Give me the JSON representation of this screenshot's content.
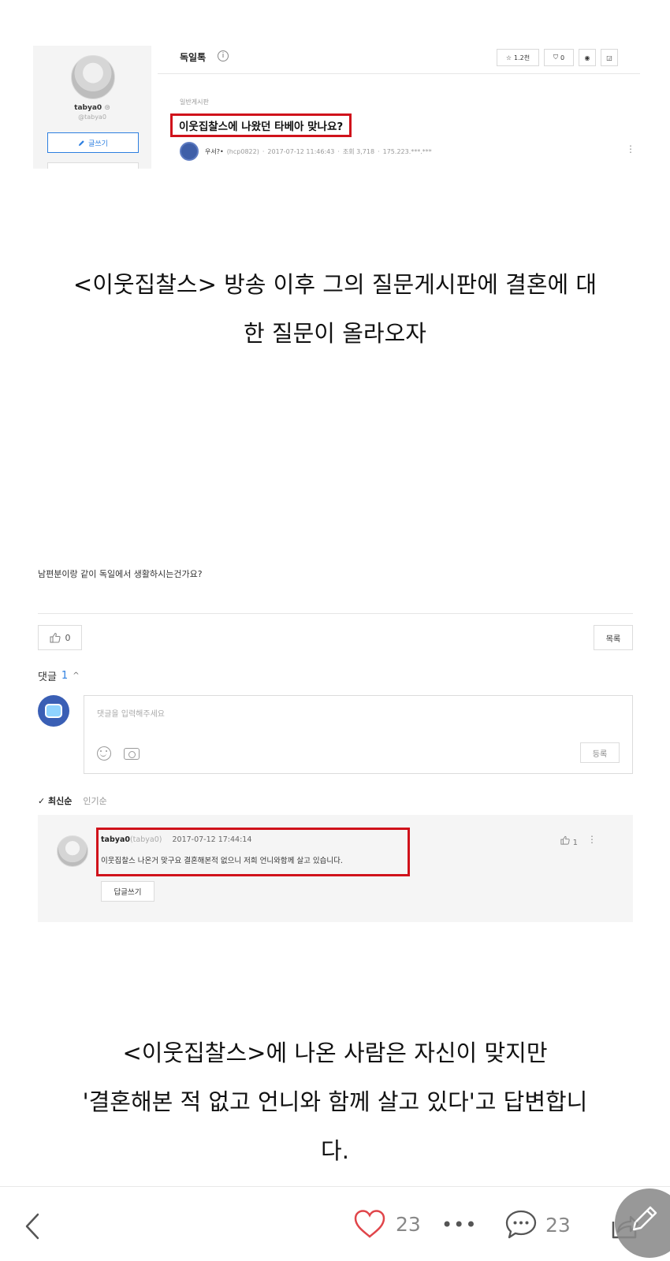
{
  "post_header": {
    "profile_name": "tabya0",
    "profile_badge": "⊜",
    "profile_id": "@tabya0",
    "write_label": "글쓰기",
    "board_title": "독일톡",
    "info_glyph": "i",
    "toolbar": {
      "favorite_count": "1.2천",
      "notify_count": "0"
    },
    "category": "일반게시판",
    "post_title": "이웃집찰스에 나왔던 타베아 맞나요?",
    "author": "우서?•",
    "author_id": "(hcp0822)",
    "date": "2017-07-12 11:46:43",
    "views": "조회 3,718",
    "ip": "175.223.***.***"
  },
  "captions": {
    "first": [
      "<이웃집찰스> 방송 이후 그의 질문게시판에 결혼에 대",
      "한 질문이 올라오자"
    ],
    "second": [
      "<이웃집찰스>에 나온 사람은 자신이 맞지만",
      "'결혼해본 적 없고 언니와 함께 살고 있다'고 답변합니",
      "다."
    ]
  },
  "question": {
    "text": "남편분이랑 같이 독일에서 생활하시는건가요?",
    "like_count": "0",
    "list_label": "목록"
  },
  "comments": {
    "label": "댓글",
    "count": "1",
    "input_placeholder": "댓글을 입력해주세요",
    "submit_label": "등록",
    "sort_latest": "✓ 최신순",
    "sort_popular": "인기순",
    "items": [
      {
        "author": "tabya0",
        "author_id": "(tabya0)",
        "date": "2017-07-12 17:44:14",
        "text": "이웃집찰스 나온거 맞구요 결혼해본적 없으니 저희 언니와함께 살고 있습니다.",
        "like_count": "1",
        "reply_label": "답글쓰기"
      }
    ]
  },
  "bottom_bar": {
    "like_count": "23",
    "more_glyph": "•••",
    "comment_count": "23"
  },
  "colors": {
    "highlight_red": "#d0121b",
    "accent_blue": "#2d7fe0",
    "heart_red": "#e0454a"
  }
}
